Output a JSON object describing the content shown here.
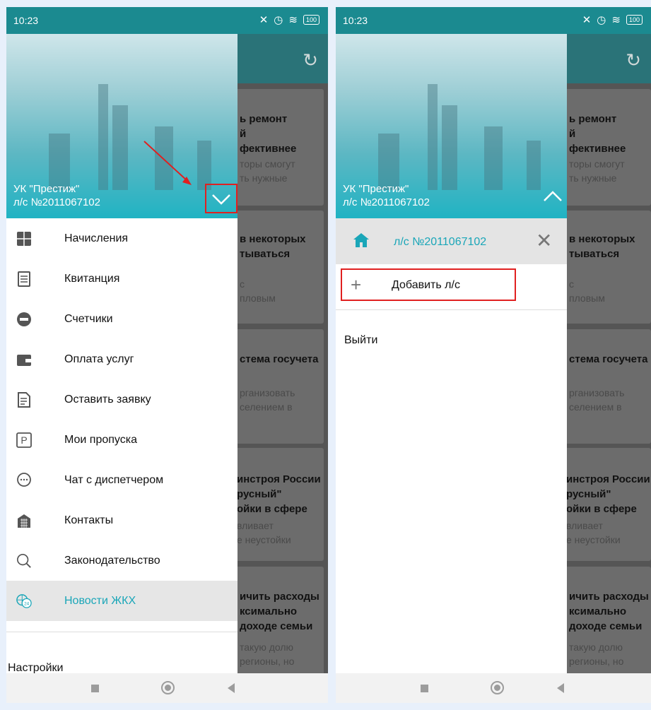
{
  "status": {
    "time": "10:23",
    "battery": "100"
  },
  "left_drawer": {
    "org_name": "УК \"Престиж\"",
    "account": "л/с №2011067102",
    "menu": [
      {
        "label": "Начисления",
        "icon": "calculator-icon",
        "glyph": "▦"
      },
      {
        "label": "Квитанция",
        "icon": "receipt-icon",
        "glyph": "▤"
      },
      {
        "label": "Счетчики",
        "icon": "meter-icon",
        "glyph": "●"
      },
      {
        "label": "Оплата услуг",
        "icon": "wallet-icon",
        "glyph": "▬"
      },
      {
        "label": "Оставить заявку",
        "icon": "request-document-icon",
        "glyph": "▧"
      },
      {
        "label": "Мои пропуска",
        "icon": "parking-pass-icon",
        "glyph": "P"
      },
      {
        "label": "Чат с диспетчером",
        "icon": "chat-icon",
        "glyph": "…"
      },
      {
        "label": "Контакты",
        "icon": "building-icon",
        "glyph": "▥"
      },
      {
        "label": "Законодательство",
        "icon": "search-icon",
        "glyph": "○"
      },
      {
        "label": "Новости ЖКХ",
        "icon": "news-24-icon",
        "glyph": "24"
      }
    ],
    "settings_label": "Настройки"
  },
  "right_drawer": {
    "org_name": "УК \"Престиж\"",
    "account": "л/с №2011067102",
    "account_link": "л/с №2011067102",
    "add_account_label": "Добавить л/с",
    "logout_label": "Выйти"
  },
  "background_news": [
    {
      "title": "ь ремонт\nй\nфективнее",
      "sub": "торы смогут\nть нужные"
    },
    {
      "title": "в некоторых\nтываться",
      "sub": "с\nпловым"
    },
    {
      "title": "стема госучета",
      "sub": "рганизовать\nселением в"
    },
    {
      "title": "инстроя России\nрусный\"\nойки в сфере",
      "sub": "вливает\nе неустойки"
    },
    {
      "title": "ичить расходы\nксимально\nдоходе семьи",
      "sub": "такую долю\nрегионы, но\nвне она не"
    }
  ],
  "background_news_right": [
    {
      "title": "ь ремонт\nй\nфективнее",
      "sub": "торы смогут\nть нужные"
    },
    {
      "title": "в некоторых\nтываться",
      "sub": "с\nпловым"
    },
    {
      "title": "стема госучета",
      "sub": "рганизовать\nселением в"
    },
    {
      "title": "инстроя России\nрусный\"\nойки в сфере",
      "sub": "вливает\nе неустойки"
    },
    {
      "title": "ичить расходы\nксимально\nдоходе семьи",
      "sub": "такую долю\nрегионы, но\nвне она не"
    }
  ],
  "colors": {
    "accent": "#1aa6b8",
    "highlight": "#e02020",
    "status_bar": "#1b8a90"
  }
}
